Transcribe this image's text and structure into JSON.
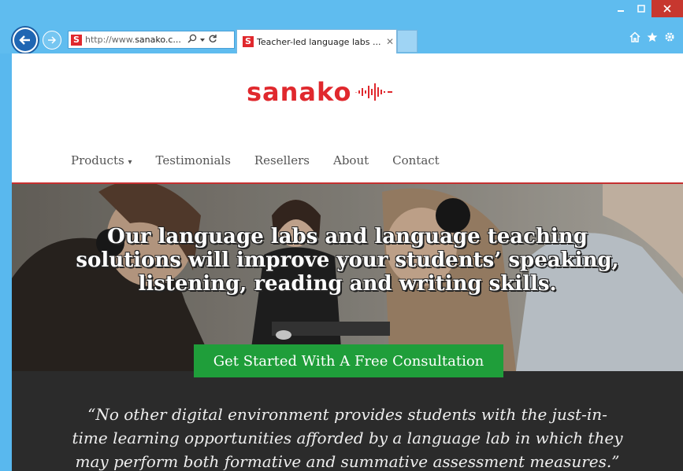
{
  "browser": {
    "address_host_prefix": "http://www.",
    "address_host_bold": "sanako.c...",
    "tab_title": "Teacher-led language labs ...",
    "favicon_letter": "S",
    "icons": [
      "back-arrow-icon",
      "forward-arrow-icon",
      "search-icon",
      "dropdown-icon",
      "refresh-icon",
      "close-icon",
      "home-icon",
      "favorites-star-icon",
      "settings-gear-icon",
      "minimize-icon",
      "maximize-icon"
    ]
  },
  "site": {
    "logo_text": "sanako",
    "nav": [
      "Products",
      "Testimonials",
      "Resellers",
      "About",
      "Contact"
    ],
    "hero_line1": "Our language labs and language teaching",
    "hero_line2": "solutions will improve your students’ speaking,",
    "hero_line3": "listening, reading and writing skills.",
    "cta_label": "Get Started With A Free Consultation",
    "quote_line1": "“No other digital environment provides students with the just-in-",
    "quote_line2": "time learning opportunities afforded by a language lab in which they",
    "quote_line3": "may perform both formative and summative assessment measures.”"
  },
  "colors": {
    "brand_red": "#e0282d",
    "cta_green": "#1f9e3a",
    "chrome_blue": "#5fbcef",
    "quote_band": "#2b2b2b"
  }
}
